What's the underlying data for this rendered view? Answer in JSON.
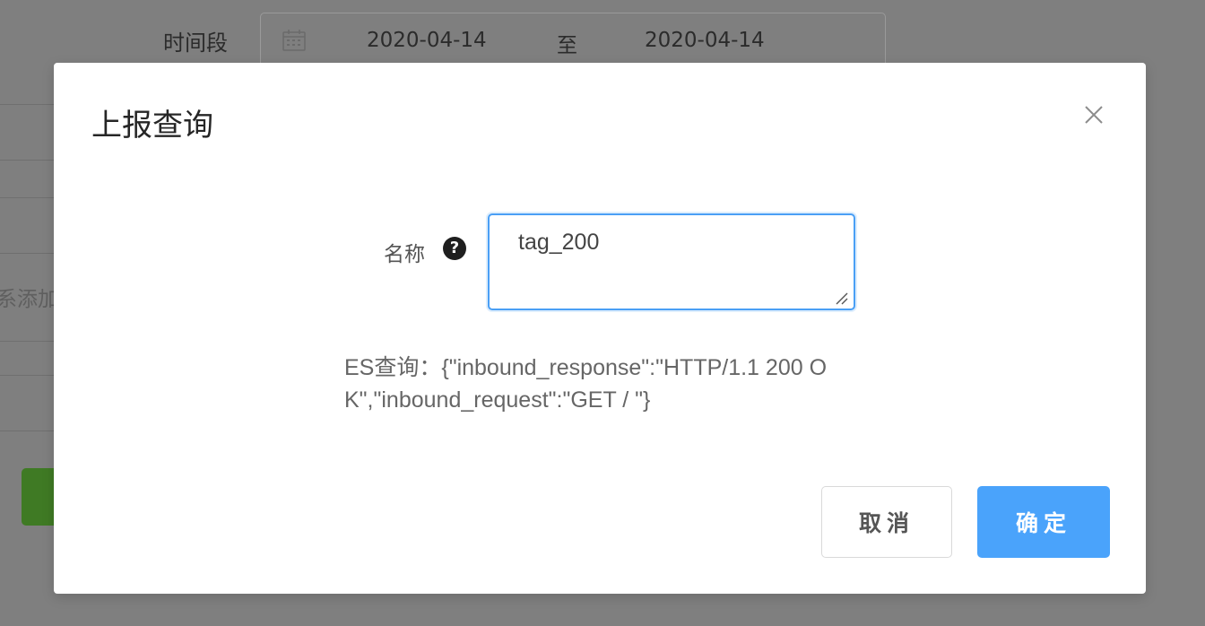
{
  "background": {
    "time_range_label": "时间段",
    "start_date": "2020-04-14",
    "range_separator": "至",
    "end_date": "2020-04-14",
    "partial_text": "系添加"
  },
  "modal": {
    "title": "上报查询",
    "close_icon": "close-icon",
    "name_label": "名称",
    "help_icon": "question-circle-icon",
    "name_value": "tag_200",
    "es_query_text": "ES查询：{\"inbound_response\":\"HTTP/1.1 200 OK\",\"inbound_request\":\"GET / \"}",
    "cancel_label": "取消",
    "ok_label": "确定"
  },
  "colors": {
    "overlay": "#7f7f7f",
    "primary": "#4aa3fb",
    "input_focus_border": "#4a9ff5",
    "bg_button_green": "#3f7a24"
  }
}
